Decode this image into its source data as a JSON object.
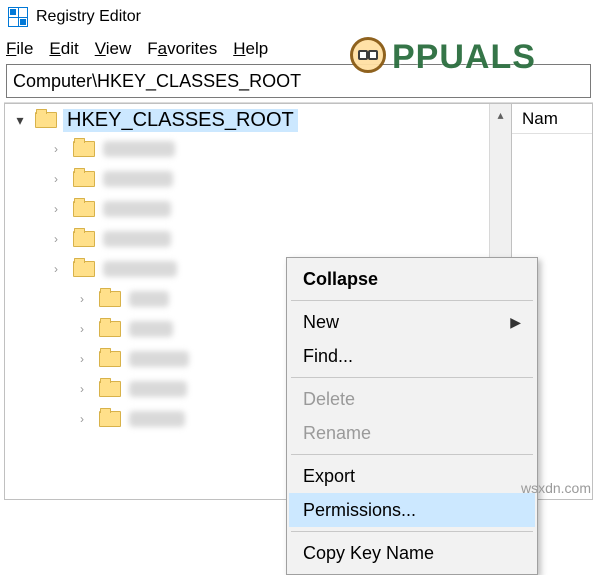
{
  "titlebar": {
    "title": "Registry Editor"
  },
  "menubar": {
    "file": "File",
    "edit": "Edit",
    "view": "View",
    "favorites": "Favorites",
    "help": "Help"
  },
  "addressbar": {
    "path": "Computer\\HKEY_CLASSES_ROOT"
  },
  "tree": {
    "root_label": "HKEY_CLASSES_ROOT",
    "child_widths": [
      72,
      70,
      68,
      68,
      74,
      40,
      44,
      60,
      58,
      56
    ]
  },
  "list": {
    "column_name": "Nam"
  },
  "context_menu": {
    "collapse": "Collapse",
    "new": "New",
    "find": "Find...",
    "delete": "Delete",
    "rename": "Rename",
    "export": "Export",
    "permissions": "Permissions...",
    "copy_key_name": "Copy Key Name"
  },
  "watermark": {
    "brand": "PPUALS",
    "source": "wsxdn.com"
  }
}
